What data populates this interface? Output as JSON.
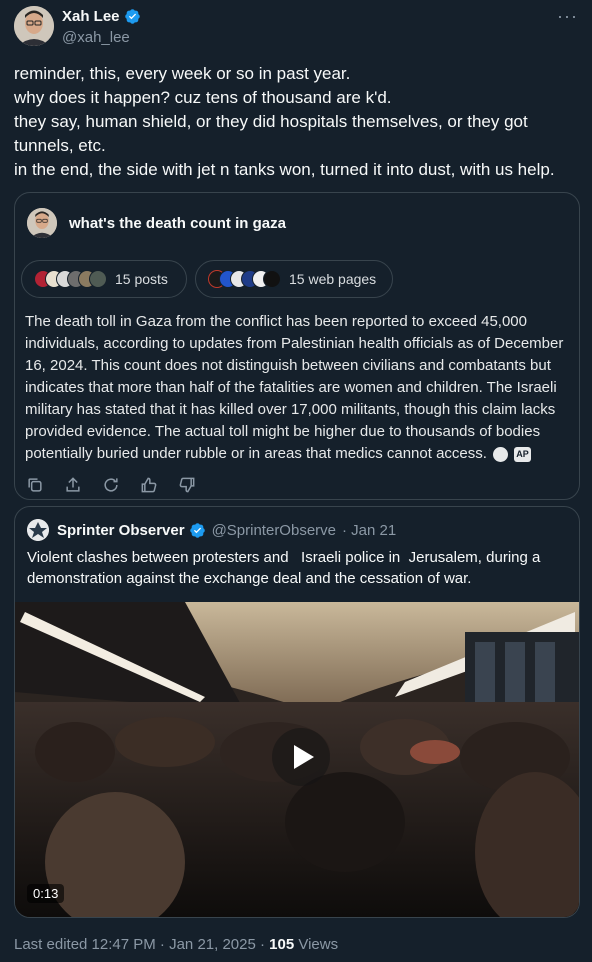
{
  "author": {
    "name": "Xah Lee",
    "handle": "@xah_lee",
    "more_label": "···"
  },
  "tweet": {
    "lines": [
      "reminder, this, every week or so in past year.",
      "why does it happen? cuz tens of thousand are k'd.",
      "they say, human shield, or they did hospitals themselves, or they got",
      "tunnels, etc.",
      "in the end, the side with jet n tanks won, turned it into dust, with us help."
    ]
  },
  "grok": {
    "question": "what's the death count in gaza",
    "posts_label": "15 posts",
    "web_label": "15 web pages",
    "answer": "The death toll in Gaza from the conflict has been reported to exceed 45,000 individuals, according to updates from Palestinian health officials as of December 16, 2024. This count does not distinguish between civilians and combatants but indicates that more than half of the fatalities are women and children. The Israeli military has stated that it has killed over 17,000 militants, though this claim lacks provided evidence. The actual toll might be higher due to thousands of bodies potentially buried under rubble or in areas that medics cannot access.",
    "source_badge": "AP",
    "actions": [
      "copy-icon",
      "share-icon",
      "regenerate-icon",
      "thumbs-up-icon",
      "thumbs-down-icon"
    ]
  },
  "quote": {
    "name": "Sprinter Observer",
    "handle": "@SprinterObserve",
    "date": "· Jan 21",
    "lines": [
      "Violent clashes between protesters and   Israeli police in  Jerusalem, during a",
      "demonstration against the exchange deal and the cessation of war."
    ],
    "duration": "0:13"
  },
  "footer": {
    "edited": "Last edited 12:47 PM · Jan 21, 2025 · ",
    "views_count": "105",
    "views_label": " Views"
  },
  "colors": {
    "background": "#15202b",
    "border": "#38444d",
    "muted": "#8b98a5",
    "verified": "#1d9bf0"
  }
}
